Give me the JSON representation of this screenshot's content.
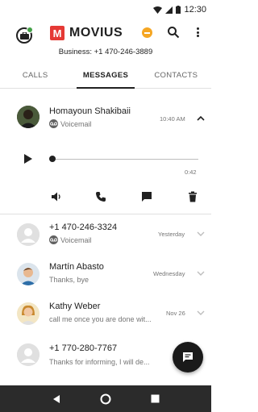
{
  "status_bar": {
    "time": "12:30"
  },
  "header": {
    "app_name": "MOVIUS",
    "logo_letter": "M",
    "business_line": "Business: +1 470-246-3889",
    "presence_color": "#43a047",
    "dnd_color": "#f5a623",
    "brand_color": "#e53935"
  },
  "tabs": [
    {
      "label": "CALLS",
      "active": false
    },
    {
      "label": "MESSAGES",
      "active": true
    },
    {
      "label": "CONTACTS",
      "active": false
    }
  ],
  "expanded_message": {
    "name": "Homayoun Shakibaii",
    "type": "Voicemail",
    "time": "10:40 AM",
    "duration": "0:42",
    "progress": 0,
    "actions": [
      "speaker-icon",
      "call-icon",
      "message-icon",
      "delete-icon"
    ]
  },
  "messages": [
    {
      "name": "+1 470-246-3324",
      "preview": "Voicemail",
      "is_voicemail": true,
      "time": "Yesterday",
      "avatar": "placeholder"
    },
    {
      "name": "Martín Abasto",
      "preview": "Thanks, bye",
      "is_voicemail": false,
      "time": "Wednesday",
      "avatar": "photo-man"
    },
    {
      "name": "Kathy Weber",
      "preview": "call me once you are done wit...",
      "is_voicemail": false,
      "time": "Nov 26",
      "avatar": "photo-woman"
    },
    {
      "name": "+1 770-280-7767",
      "preview": "Thanks for informing, I will de...",
      "is_voicemail": false,
      "time": "",
      "avatar": "placeholder"
    }
  ],
  "fab": {
    "icon": "new-message-icon"
  }
}
